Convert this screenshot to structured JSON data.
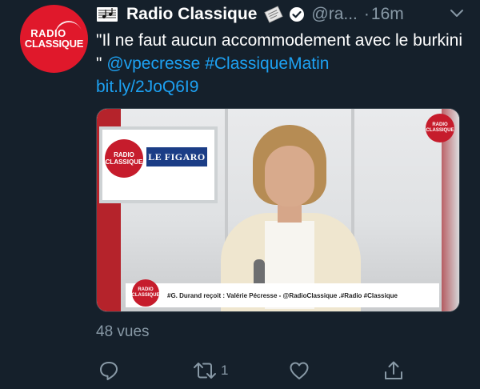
{
  "tweet": {
    "author_name": "Radio Classique",
    "handle": "@ra...",
    "separator": "·",
    "time": "16m",
    "text": "\"Il ne faut aucun accommodement avec le burkini \"",
    "mention": "@vpecresse",
    "hashtag": "#ClassiqueMatin",
    "link": "bit.ly/2JoQ6I9",
    "avatar_text_top": "RADIO",
    "avatar_text_bottom": "CLASSIQUE",
    "views": "48 vues",
    "retweet_count": "1",
    "icons": [
      "music-score-icon",
      "newspaper-icon",
      "verified-badge-icon",
      "chevron-down-icon",
      "reply-icon",
      "retweet-icon",
      "like-icon",
      "share-icon"
    ]
  },
  "media": {
    "screen_logo_top": "RADIO",
    "screen_logo_bottom": "CLASSIQUE",
    "figaro": "LE FIGARO",
    "corner_logo_top": "RADIO",
    "corner_logo_bottom": "CLASSIQUE",
    "banner_logo_top": "RADIO",
    "banner_logo_bottom": "CLASSIQUE",
    "banner_text": "#G. Durand reçoit : Valérie Pécresse - @RadioClassique .#Radio #Classique"
  },
  "colors": {
    "background": "#15202b",
    "link": "#1da1f2",
    "muted": "#8899a6",
    "brand_red": "#e0182b"
  }
}
